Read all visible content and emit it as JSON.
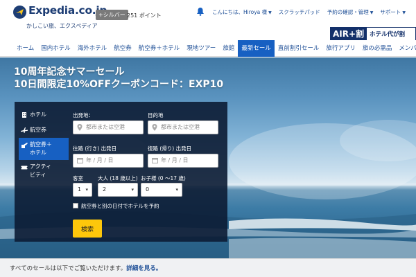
{
  "brand": {
    "name": "Expedia.co.jp",
    "tagline": "かしこい旅、エクスペディア",
    "member_tier": "+シルバー",
    "points": "251 ポイント"
  },
  "top_links": [
    {
      "label": "こんにちは、Hiroya 様",
      "dropdown": true
    },
    {
      "label": "スクラッチパッド",
      "dropdown": false
    },
    {
      "label": "予約の確認・管理",
      "dropdown": true
    },
    {
      "label": "サポート",
      "dropdown": true
    }
  ],
  "ad": {
    "logo": "AIR+割",
    "message": "ホテル代が割"
  },
  "nav": [
    "ホーム",
    "国内ホテル",
    "海外ホテル",
    "航空券",
    "航空券＋ホテル",
    "現地ツアー",
    "旅館",
    "最新セール",
    "直前割引セール",
    "旅行アプリ",
    "旅の必需品",
    "メンバ"
  ],
  "nav_active": "最新セール",
  "hero": {
    "line1": "10周年記念サマーセール",
    "line2": "10日間限定10%OFFクーポンコード：EXP10"
  },
  "search": {
    "tabs": [
      {
        "line1": "ホテル",
        "line2": "",
        "icon": "hotel-icon"
      },
      {
        "line1": "航空券",
        "line2": "",
        "icon": "airplane-icon"
      },
      {
        "line1": "航空券＋",
        "line2": "ホテル",
        "icon": "plane-hotel-icon"
      },
      {
        "line1": "アクティ",
        "line2": "ビティ",
        "icon": "ticket-icon"
      }
    ],
    "active_tab": 2,
    "origin_label": "出発地：",
    "origin_placeholder": "都市または空港",
    "dest_label": "目的地",
    "dest_placeholder": "都市または空港",
    "depart_label": "往路 (行き) 出発日",
    "depart_placeholder": "年 / 月 / 日",
    "return_label": "復路 (帰り) 出発日",
    "return_placeholder": "年 / 月 / 日",
    "rooms_label": "客室",
    "rooms_value": "1",
    "adults_label": "大人 (18 歳以上)",
    "adults_value": "2",
    "children_label": "お子様 (0 ～17 歳)",
    "children_value": "0",
    "diff_dates_label": "航空券と別の日付でホテルを予約",
    "submit_label": "検索"
  },
  "footer": {
    "text": "すべてのセールは以下でご覧いただけます。",
    "link": "詳細を見る。"
  },
  "colors": {
    "brand_navy": "#1d3d74",
    "link_blue": "#1d4e96",
    "active_blue": "#1760c2",
    "search_button": "#fdc70b"
  }
}
